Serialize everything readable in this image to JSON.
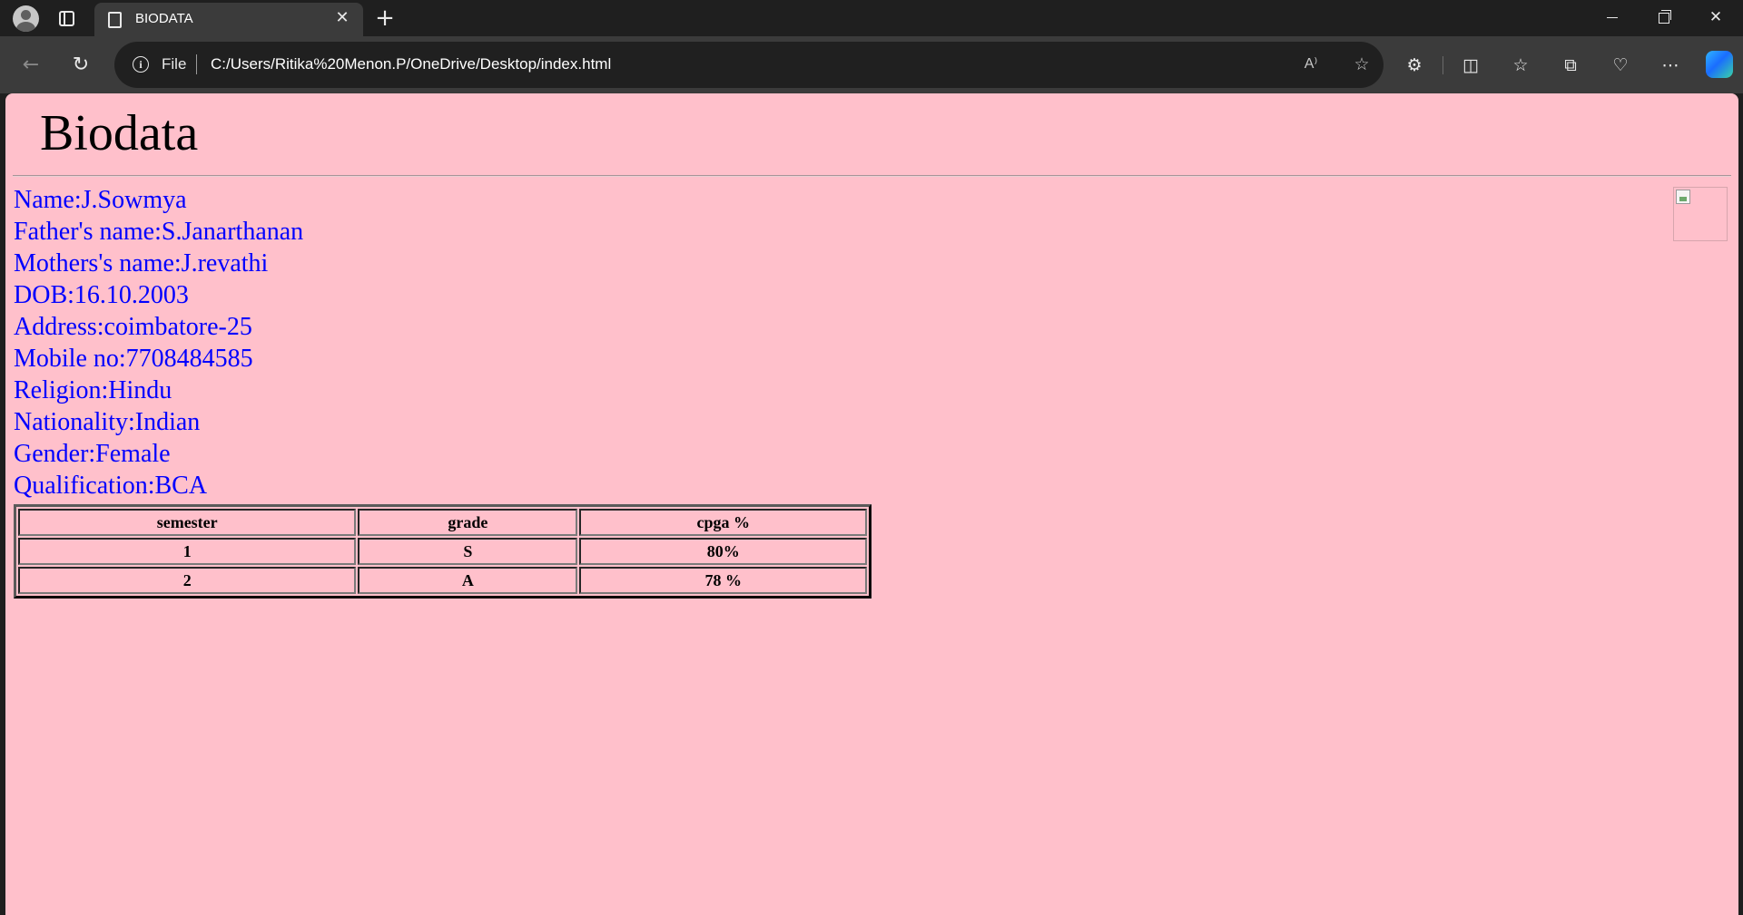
{
  "browser": {
    "tab_title": "BIODATA",
    "close_tab_glyph": "✕",
    "new_tab_glyph": "+",
    "address": {
      "file_label": "File",
      "url": "C:/Users/Ritika%20Menon.P/OneDrive/Desktop/index.html",
      "read_aloud_glyph": "A⁾"
    },
    "icons": [
      "profile-icon",
      "tab-actions-icon",
      "document-icon",
      "back-icon",
      "reload-icon",
      "info-icon",
      "read-aloud-icon",
      "favorite-star-icon",
      "extensions-icon",
      "split-screen-icon",
      "favorites-icon",
      "collections-icon",
      "browser-essentials-icon",
      "more-icon",
      "copilot-icon",
      "minimize-icon",
      "restore-icon",
      "close-icon"
    ]
  },
  "page": {
    "heading": "Biodata",
    "details": [
      "Name:J.Sowmya",
      "Father's name:S.Janarthanan",
      "Mothers's name:J.revathi",
      "DOB:16.10.2003",
      "Address:coimbatore-25",
      "Mobile no:7708484585",
      "Religion:Hindu",
      "Nationality:Indian",
      "Gender:Female",
      "Qualification:BCA"
    ],
    "table": {
      "headers": [
        "semester",
        "grade",
        "cpga %"
      ],
      "rows": [
        [
          "1",
          "S",
          "80%"
        ],
        [
          "2",
          "A",
          "78 %"
        ]
      ]
    }
  },
  "colors": {
    "page_background": "#ffc0cb",
    "detail_text": "#0000ff",
    "browser_frame": "#1f1f1f",
    "toolbar": "#3b3b3b"
  }
}
